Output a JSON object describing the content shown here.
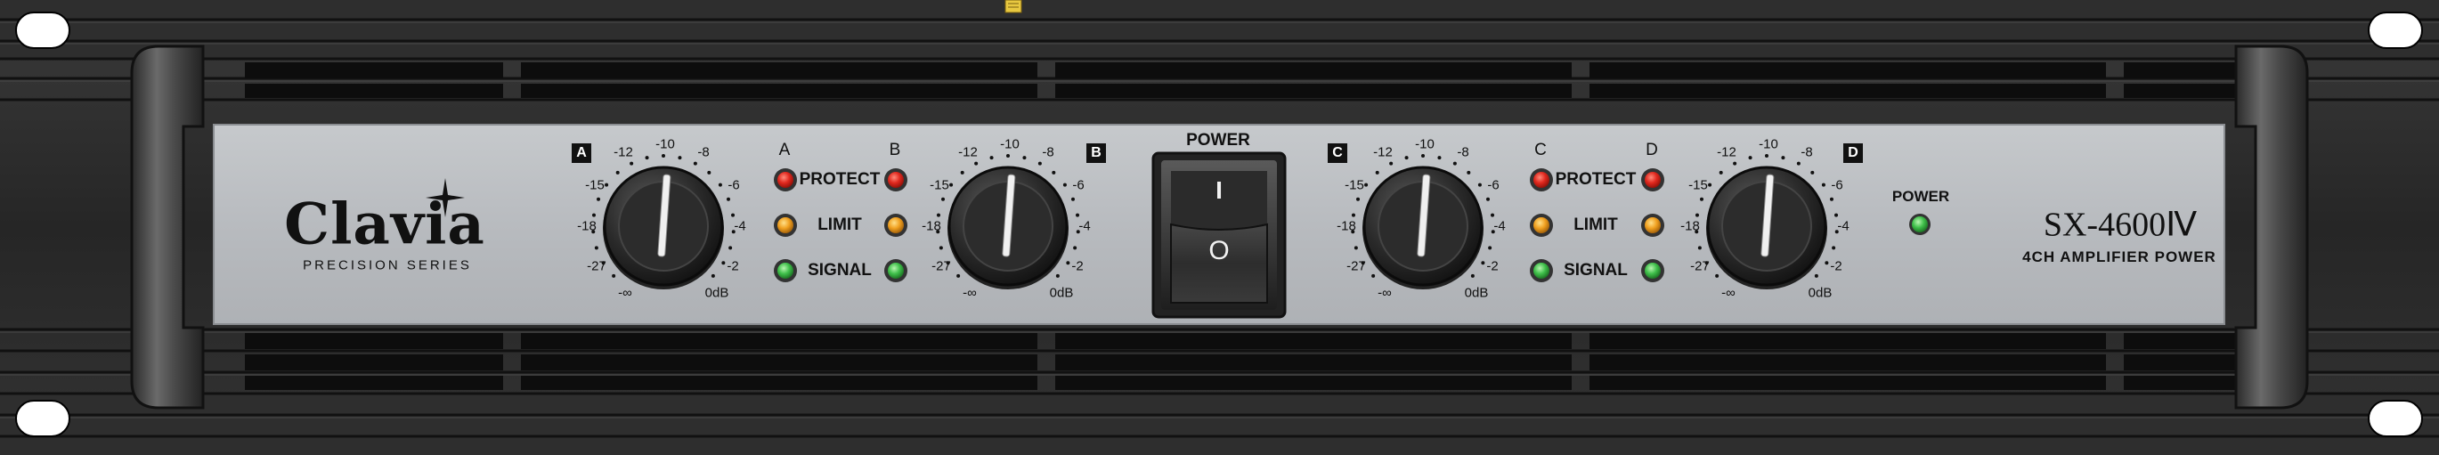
{
  "brand": {
    "name": "Clavia",
    "series": "PRECISION SERIES"
  },
  "model": {
    "name": "SX-4600Ⅳ",
    "tagline": "4CH AMPLIFIER POWER"
  },
  "power_switch": {
    "label": "POWER",
    "on_symbol": "I",
    "off_symbol": "O"
  },
  "power_led": {
    "label": "POWER",
    "color": "#3fbf4a"
  },
  "knob_scale": [
    "-12",
    "-10",
    "-8",
    "-15",
    "-6",
    "-18",
    "-4",
    "-27",
    "-2",
    "-∞",
    "0dB"
  ],
  "channels": [
    {
      "letter": "A"
    },
    {
      "letter": "B"
    },
    {
      "letter": "C"
    },
    {
      "letter": "D"
    }
  ],
  "indicator_groups": [
    {
      "left_channel": "A",
      "right_channel": "B",
      "rows": [
        {
          "label": "PROTECT",
          "color": "red",
          "hex": "#e0281e"
        },
        {
          "label": "LIMIT",
          "color": "amber",
          "hex": "#f0a020"
        },
        {
          "label": "SIGNAL",
          "color": "green",
          "hex": "#3fbf4a"
        }
      ]
    },
    {
      "left_channel": "C",
      "right_channel": "D",
      "rows": [
        {
          "label": "PROTECT",
          "color": "red",
          "hex": "#e0281e"
        },
        {
          "label": "LIMIT",
          "color": "amber",
          "hex": "#f0a020"
        },
        {
          "label": "SIGNAL",
          "color": "green",
          "hex": "#3fbf4a"
        }
      ]
    }
  ],
  "colors": {
    "faceplate": "#b9bcc0",
    "chassis": "#1c1c1c",
    "handle": "#3a3a3a"
  }
}
